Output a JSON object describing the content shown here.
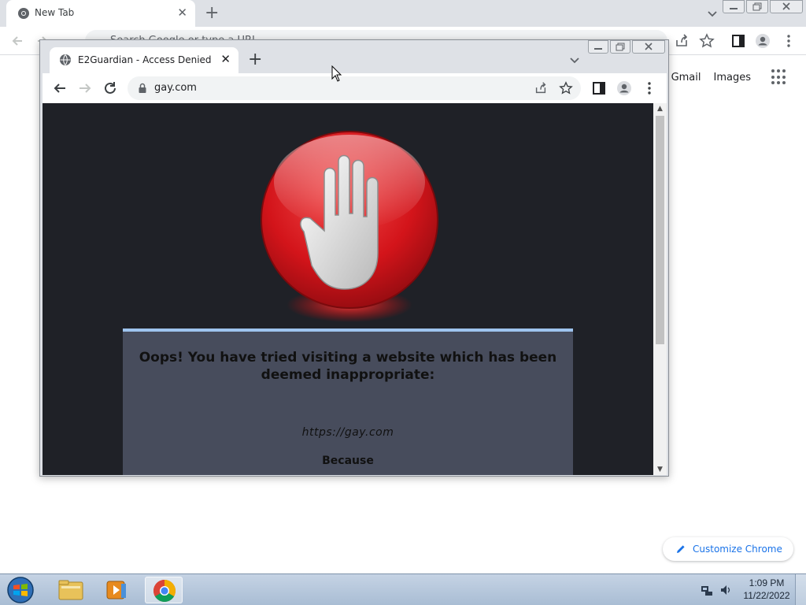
{
  "background_window": {
    "tab": {
      "title": "New Tab",
      "close": "✕"
    },
    "new_tab": "+",
    "omnibox": {
      "placeholder": "Search Google or type a URL"
    },
    "links": [
      "Gmail",
      "Images"
    ],
    "customize_label": "Customize Chrome"
  },
  "foreground_window": {
    "tab": {
      "title": "E2Guardian - Access Denied",
      "close": "✕"
    },
    "new_tab": "+",
    "omnibox": {
      "url": "gay.com"
    }
  },
  "page": {
    "heading": "Oops! You have tried visiting a website which has been deemed inappropriate:",
    "blocked_url": "https://gay.com",
    "because_label": "Because"
  },
  "taskbar": {
    "apps": [
      "start-button",
      "file-explorer",
      "media-player",
      "chrome"
    ],
    "clock": {
      "time": "1:09 PM",
      "date": "11/22/2022"
    }
  },
  "colors": {
    "page_bg": "#1f2127",
    "message_box_bg": "#474c5c",
    "message_box_border": "#9ec4ee",
    "stop_red": "#d3141a",
    "link_blue": "#1a73e8"
  }
}
